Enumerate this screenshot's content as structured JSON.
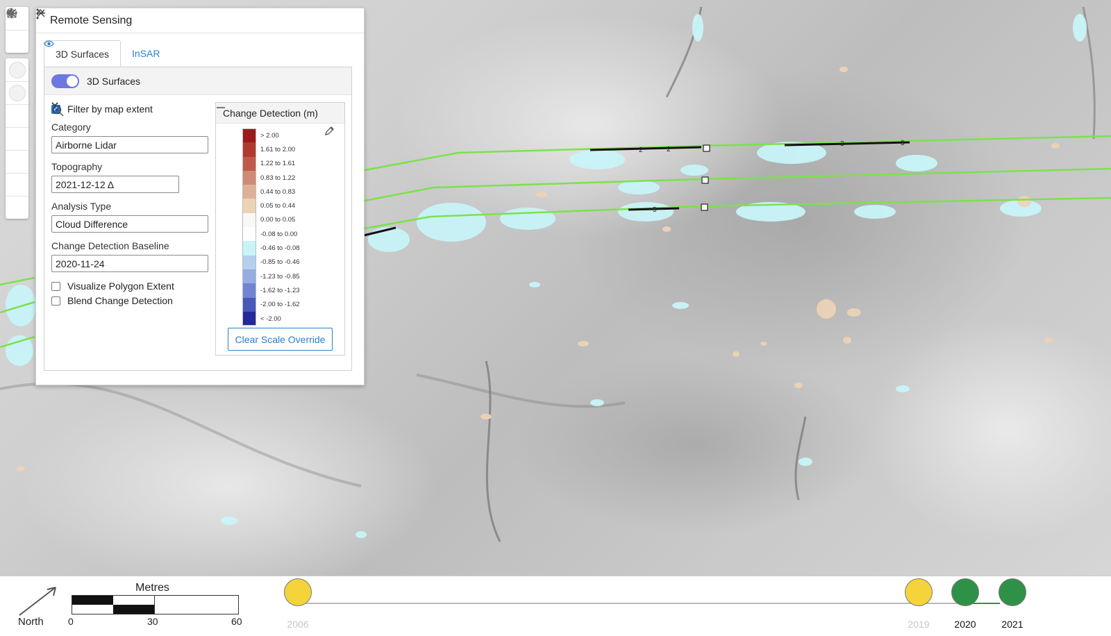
{
  "panel": {
    "title": "Remote Sensing",
    "tabs": [
      {
        "label": "3D Surfaces",
        "active": true
      },
      {
        "label": "InSAR",
        "active": false
      }
    ],
    "toggle_label": "3D Surfaces",
    "toggle_on": true,
    "filter_label": "Filter by map extent",
    "filter_checked": true,
    "category_label": "Category",
    "category_value": "Airborne Lidar",
    "topography_label": "Topography",
    "topography_value": "2021-12-12 Δ",
    "analysis_label": "Analysis Type",
    "analysis_value": "Cloud Difference",
    "baseline_label": "Change Detection Baseline",
    "baseline_value": "2020-11-24",
    "visualize_label": "Visualize Polygon Extent",
    "blend_label": "Blend Change Detection"
  },
  "legend": {
    "title": "Change Detection (m)",
    "clear_button": "Clear Scale Override",
    "entries": [
      {
        "label": "> 2.00",
        "color": "#9b1a1a"
      },
      {
        "label": "1.61 to 2.00",
        "color": "#b03a2e"
      },
      {
        "label": "1.22 to 1.61",
        "color": "#bf5a4a"
      },
      {
        "label": "0.83 to 1.22",
        "color": "#cf8a76"
      },
      {
        "label": "0.44 to 0.83",
        "color": "#ddb196"
      },
      {
        "label": "0.05 to 0.44",
        "color": "#ecd3b5"
      },
      {
        "label": "0.00 to 0.05",
        "color": "#f8f8f8"
      },
      {
        "label": "-0.08 to 0.00",
        "color": "#ffffff"
      },
      {
        "label": "-0.46 to -0.08",
        "color": "#c8f4f8"
      },
      {
        "label": "-0.85 to -0.46",
        "color": "#b3d0ee"
      },
      {
        "label": "-1.23 to -0.85",
        "color": "#94aee2"
      },
      {
        "label": "-1.62 to -1.23",
        "color": "#6e86d2"
      },
      {
        "label": "-2.00 to -1.62",
        "color": "#4658b8"
      },
      {
        "label": "< -2.00",
        "color": "#23289a"
      }
    ]
  },
  "scale": {
    "title": "Metres",
    "ticks": [
      "0",
      "30",
      "60"
    ],
    "north_label": "North"
  },
  "timeline": {
    "years": [
      {
        "label": "2006",
        "color": "#f5d33b",
        "muted": true
      },
      {
        "label": "2019",
        "color": "#f5d33b",
        "muted": true
      },
      {
        "label": "2020",
        "color": "#2f9147",
        "muted": false
      },
      {
        "label": "2021",
        "color": "#2f9147",
        "muted": false
      }
    ]
  },
  "colors": {
    "accent": "#2a7fd4",
    "toggle": "#6c79e0",
    "survey_line": "#7be24a",
    "change_negative": "#c8f4f8",
    "change_positive": "#ecd3b5"
  },
  "map_labels": [
    "2",
    "2",
    "3",
    "3",
    "5"
  ]
}
